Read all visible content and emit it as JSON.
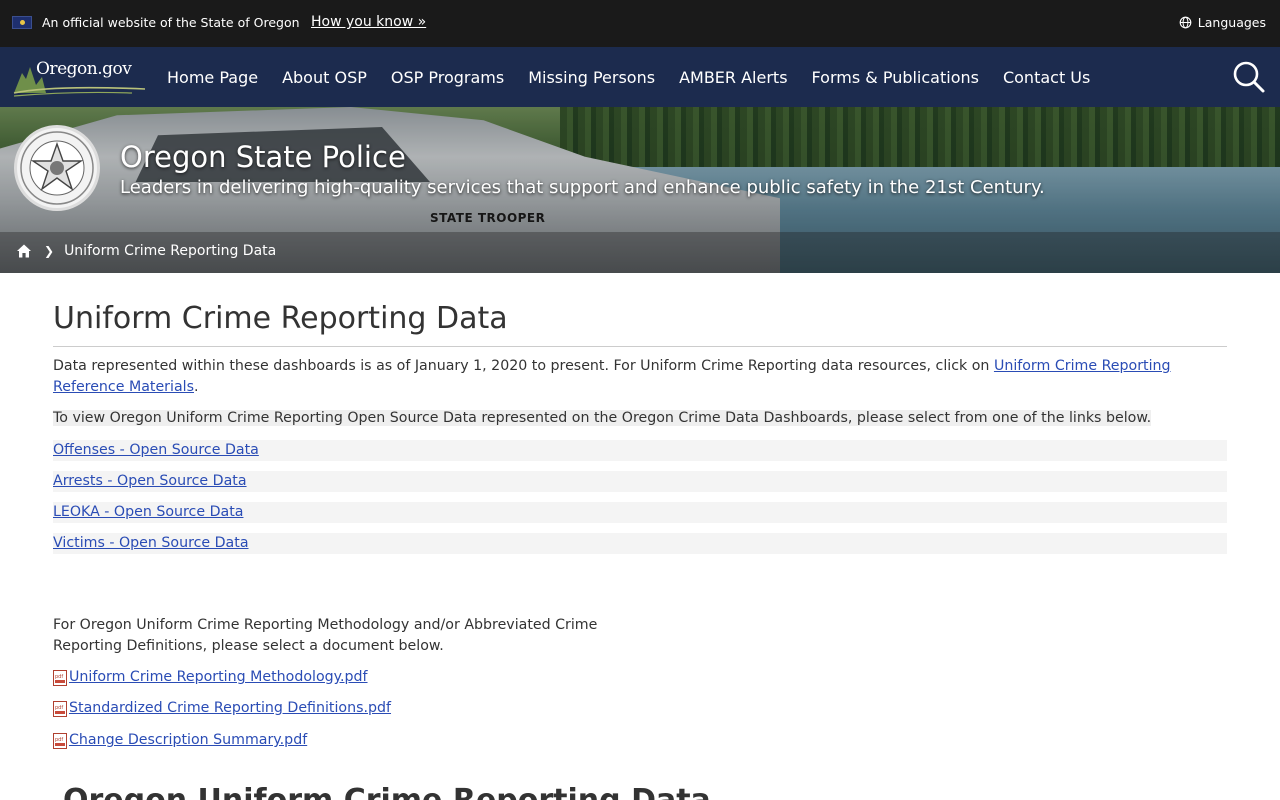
{
  "topbar": {
    "official_text": "An official website of the State of Oregon",
    "how_you_know": "How you know »",
    "languages": "Languages"
  },
  "nav": {
    "logo_text": "Oregon.gov",
    "items": [
      {
        "label": "Home Page"
      },
      {
        "label": "About OSP"
      },
      {
        "label": "OSP Programs"
      },
      {
        "label": "Missing Persons"
      },
      {
        "label": "AMBER Alerts"
      },
      {
        "label": "Forms & Publications"
      },
      {
        "label": "Contact Us"
      }
    ]
  },
  "hero": {
    "title": "Oregon State Police",
    "subtitle": "Leaders in delivering high-quality services that support and enhance public safety in the 21st Century.",
    "vehicle_text": "STATE TROOPER"
  },
  "breadcrumb": {
    "current": "Uniform Crime Reporting Data"
  },
  "main": {
    "heading": "Uniform Crime Reporting Data",
    "intro_text": "Data represented within these dashboards is as of January 1, 2020 to present. For Uniform Crime Reporting data resources, click on ",
    "intro_link": "Uniform Crime Reporting Reference Materials",
    "intro_end": ".",
    "view_text": "To view Oregon Uniform Crime Reporting Open Source Data represented on the Oregon Crime Data Dashboards, please select from one of the links below.",
    "data_links": [
      {
        "label": "Offenses - Open Source Data"
      },
      {
        "label": "Arrests - Open Source Data"
      },
      {
        "label": "LEOKA - Open Source Data"
      },
      {
        "label": "Victims - Open Source Data"
      }
    ],
    "methodology_line1": "For Oregon Uniform Crime Reporting Methodology and/or Abbreviated Crime",
    "methodology_line2": "Reporting Definitions, please select a document below.",
    "documents": [
      {
        "label": "Uniform Crime Reporting Methodology.pdf"
      },
      {
        "label": "Standardized Crime Reporting Definitions.pdf"
      },
      {
        "label": "Change Description Summary.pdf"
      }
    ],
    "section_heading": "Oregon Uniform Crime Reporting Data"
  }
}
